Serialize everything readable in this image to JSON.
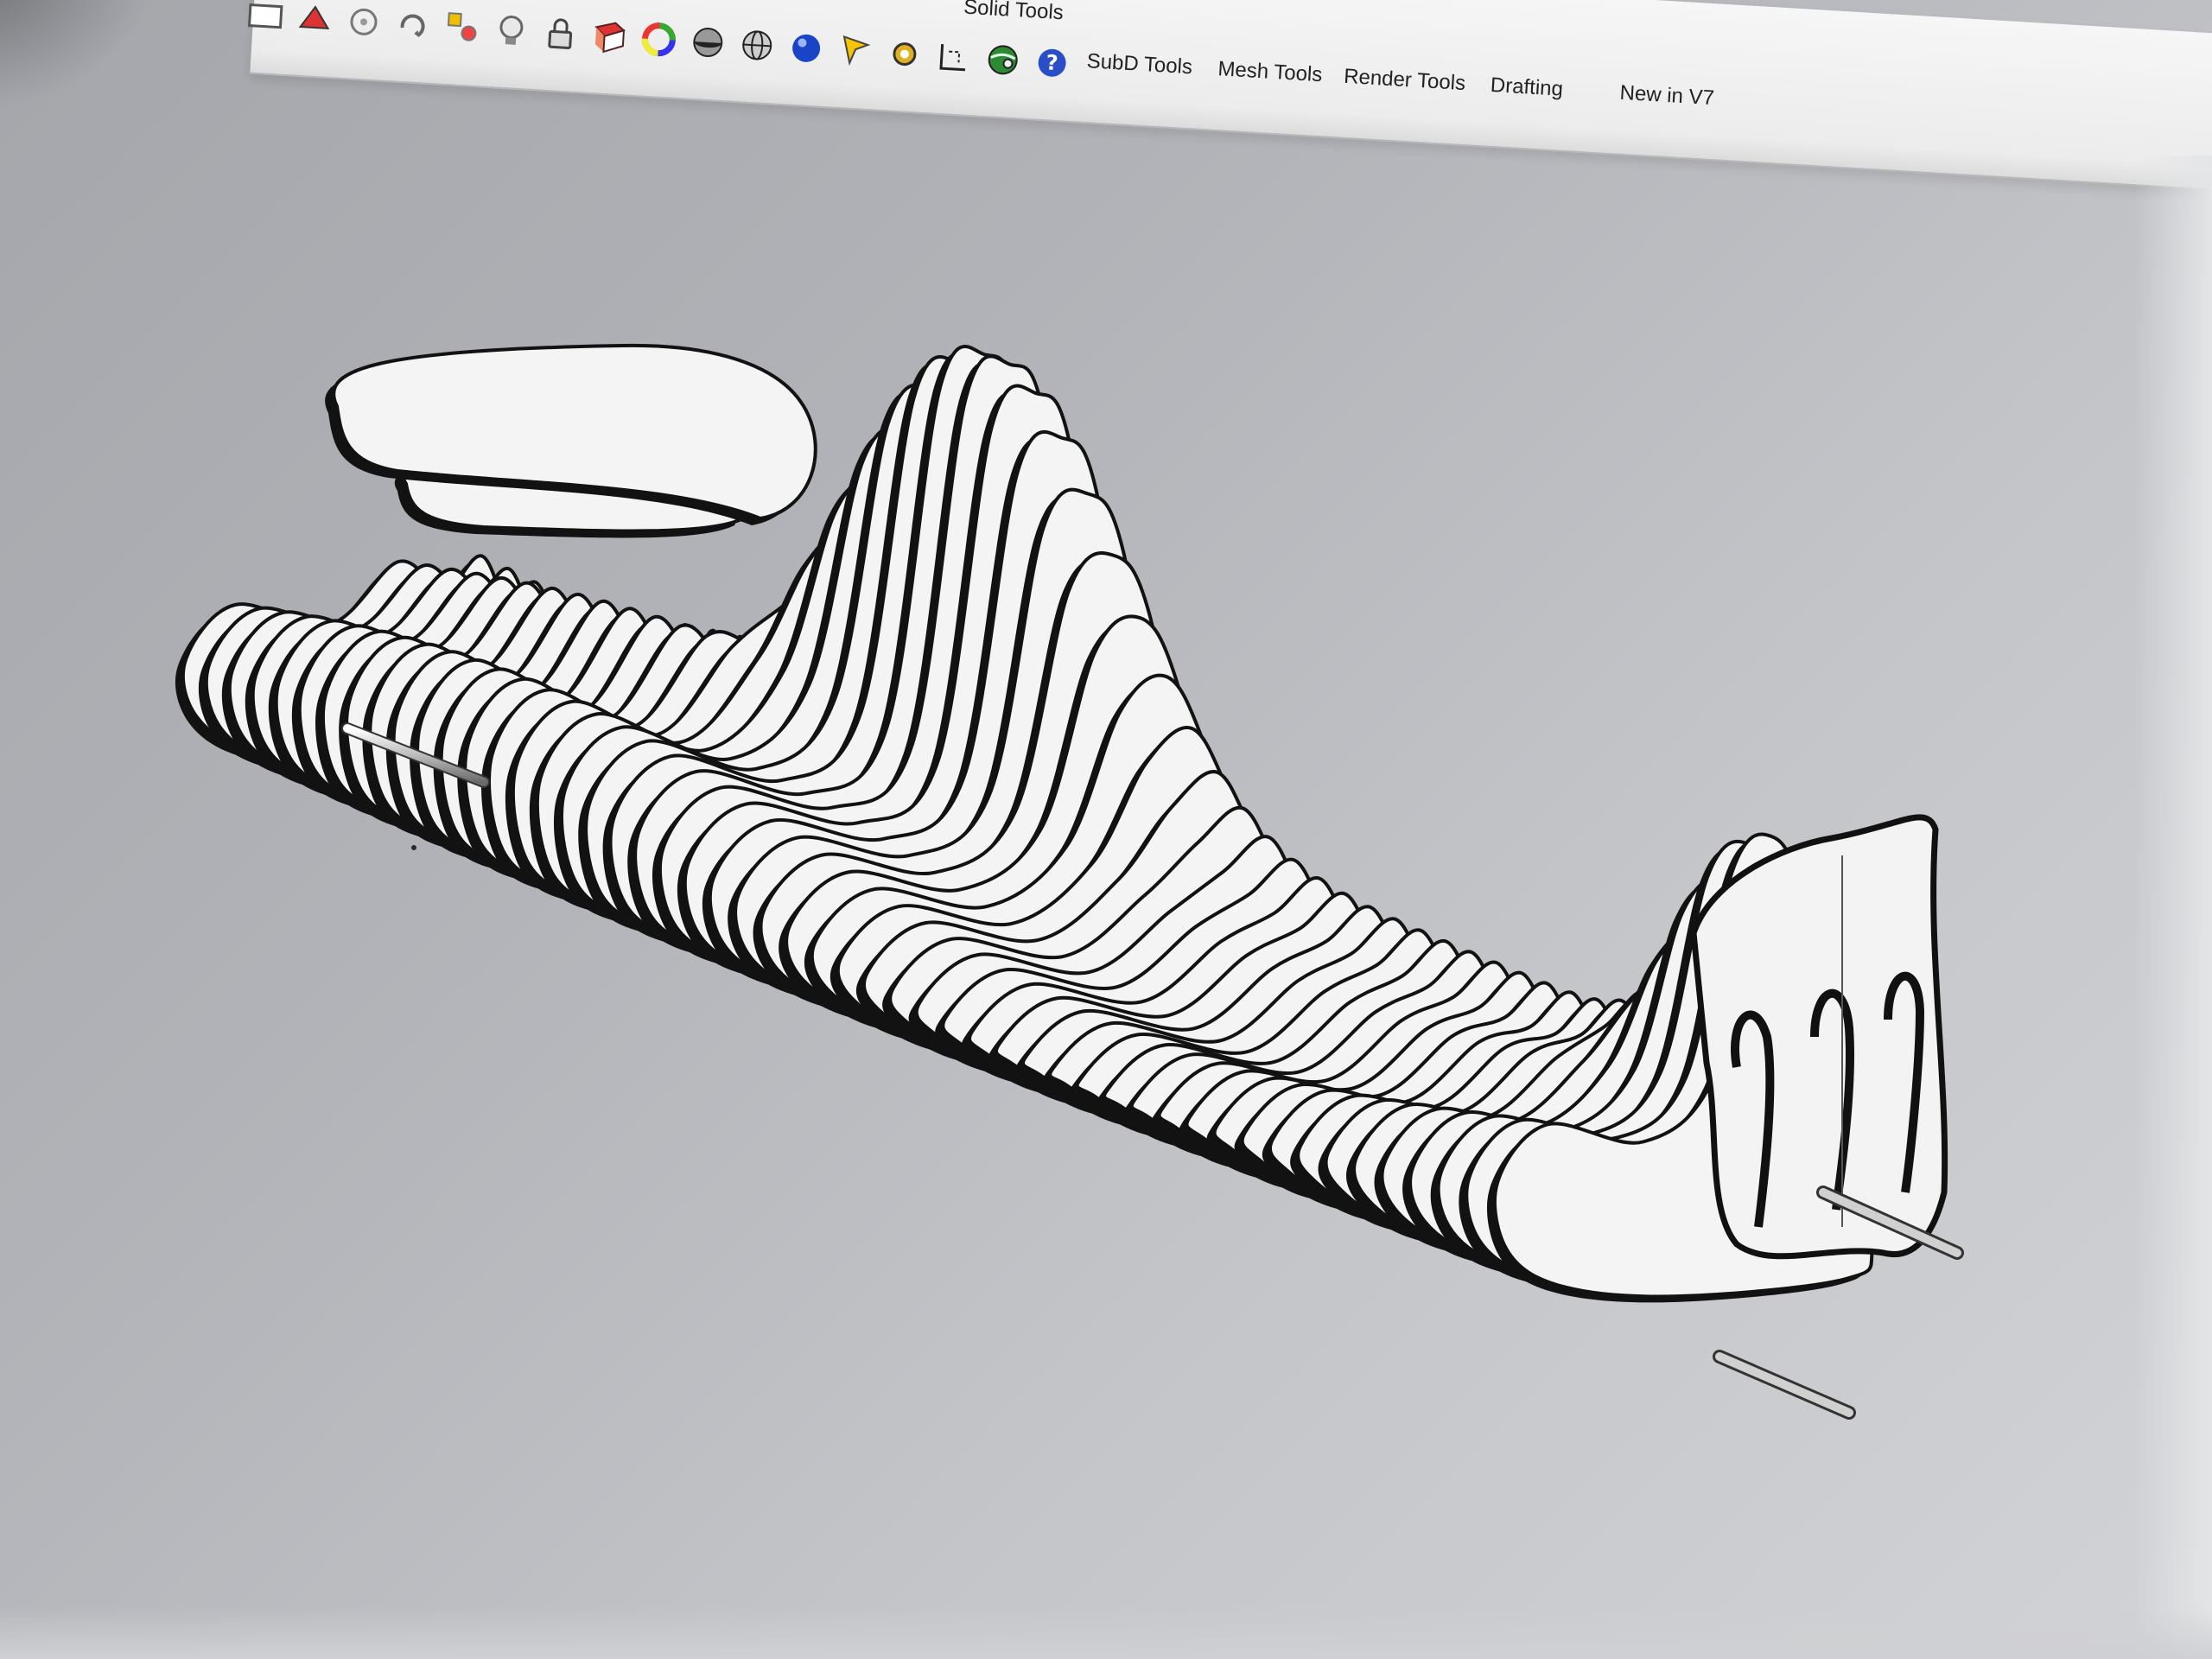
{
  "toolbar": {
    "icons": [
      "rectangle-icon",
      "shape-icon",
      "snap-icon",
      "rotate-icon",
      "group-icon",
      "lightbulb-icon",
      "lock-icon",
      "book-icon",
      "color-wheel-icon",
      "sphere-shade-icon",
      "sphere-wire-icon",
      "sphere-blue-icon",
      "cursor-icon",
      "gear-icon",
      "dimension-icon",
      "globe-icon",
      "help-icon"
    ],
    "tabs": [
      {
        "label": "Solid Tools"
      },
      {
        "label": "SubD Tools"
      },
      {
        "label": "Mesh Tools"
      },
      {
        "label": "Render Tools"
      },
      {
        "label": "Drafting"
      },
      {
        "label": "New in V7"
      }
    ]
  },
  "viewport": {
    "object": "slatted-bench-model",
    "slat_fill": "#f4f4f4",
    "slat_edge": "#121212",
    "background": "#b8babe",
    "rod_color": "#c9c9c9"
  }
}
